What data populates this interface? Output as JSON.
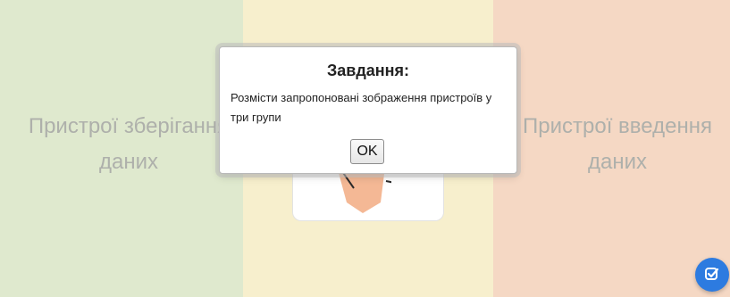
{
  "groups": {
    "left_label": "Пристрої зберігання даних",
    "right_label": "Пристрої введення даних"
  },
  "modal": {
    "title": "Завдання:",
    "text": "Розмісти запропоновані зображення пристроїв у три групи",
    "ok_label": "OK"
  },
  "icons": {
    "check_button": "check-edit-icon",
    "card_image": "hand-pointer-icon"
  },
  "colors": {
    "zone_left": "#dfe9ce",
    "zone_mid": "#f7efcd",
    "zone_right": "#f5d8c4",
    "fab": "#2d7be0"
  }
}
